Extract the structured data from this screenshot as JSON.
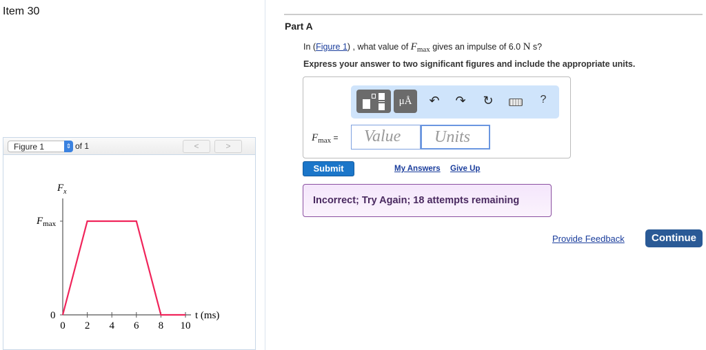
{
  "item_title": "Item 30",
  "figure_nav": {
    "selected": "Figure 1",
    "of_label": "of 1",
    "prev": "<",
    "next": ">"
  },
  "part_title": "Part A",
  "question": {
    "prefix": "In (",
    "link": "Figure 1",
    "mid": ") , what value of ",
    "var": "F",
    "sub": "max",
    "suffix": " gives an impulse of 6.0 ",
    "unit": "N",
    "unit2": " s?"
  },
  "instruction": "Express your answer to two significant figures and include the appropriate units.",
  "answer": {
    "label_var": "F",
    "label_sub": "max",
    "label_eq": " =",
    "value_placeholder": "Value",
    "units_placeholder": "Units",
    "toolbar": {
      "units_btn": "μÅ",
      "help": "?"
    }
  },
  "submit_label": "Submit",
  "my_answers_label": "My Answers",
  "give_up_label": "Give Up",
  "feedback_text": "Incorrect; Try Again; 18 attempts remaining",
  "provide_feedback_label": "Provide Feedback",
  "continue_label": "Continue",
  "chart_data": {
    "type": "line",
    "ylabel_var": "F",
    "ylabel_sub": "x",
    "ytick_var": "F",
    "ytick_sub": "max",
    "ytick_zero": "0",
    "xlabel": "t (ms)",
    "x": [
      0,
      2,
      6,
      8,
      10
    ],
    "y": [
      0,
      1,
      1,
      0,
      0
    ],
    "xticks": [
      "0",
      "2",
      "4",
      "6",
      "8",
      "10"
    ],
    "xlim": [
      0,
      10
    ],
    "ylim": [
      0,
      1
    ],
    "line_color": "#f0245a"
  }
}
